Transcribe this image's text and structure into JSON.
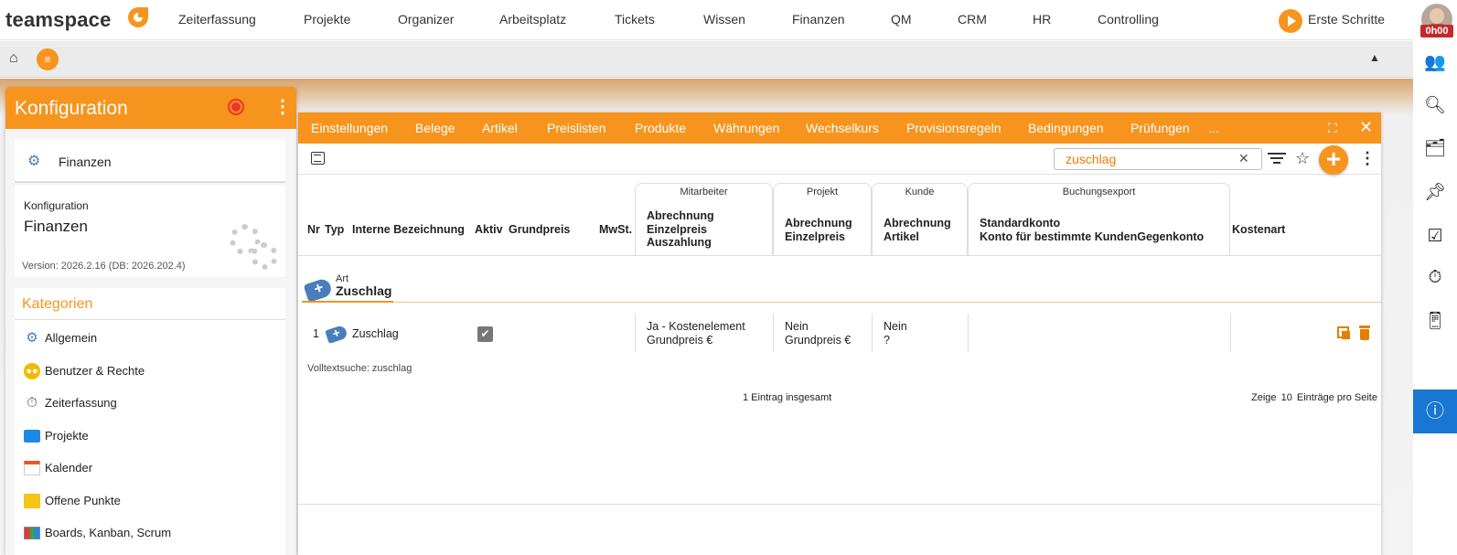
{
  "app": {
    "logo": "teamspace",
    "start_label": "Erste Schritte",
    "timer": "0h00"
  },
  "topnav": [
    "Zeiterfassung",
    "Projekte",
    "Organizer",
    "Arbeitsplatz",
    "Tickets",
    "Wissen",
    "Finanzen",
    "QM",
    "CRM",
    "HR",
    "Controlling"
  ],
  "left_panel": {
    "title": "Konfiguration",
    "card_label": "Finanzen",
    "section_small": "Konfiguration",
    "section_big": "Finanzen",
    "version": "Version: 2026.2.16 (DB: 2026.202.4)",
    "categories_title": "Kategorien",
    "categories": [
      "Allgemein",
      "Benutzer & Rechte",
      "Zeiterfassung",
      "Projekte",
      "Kalender",
      "Offene Punkte",
      "Boards, Kanban, Scrum"
    ]
  },
  "tabs": [
    "Einstellungen",
    "Belege",
    "Artikel",
    "Preislisten",
    "Produkte",
    "Währungen",
    "Wechselkurs",
    "Provisionsregeln",
    "Bedingungen",
    "Prüfungen",
    "..."
  ],
  "search": {
    "value": "zuschlag"
  },
  "columns": {
    "nr": "Nr",
    "typ": "Typ",
    "bezeichnung": "Interne Bezeichnung",
    "aktiv": "Aktiv",
    "grundpreis": "Grundpreis",
    "mwst": "MwSt.",
    "mitarbeiter_group": "Mitarbeiter",
    "mitarbeiter_col": "Abrechnung\nEinzelpreis\nAuszahlung",
    "projekt_group": "Projekt",
    "projekt_col": "Abrechnung\nEinzelpreis",
    "kunde_group": "Kunde",
    "kunde_col": "Abrechnung\nArtikel",
    "buchung_group": "Buchungsexport",
    "buchung_col": "Standardkonto\nKonto für bestimmte KundenGegenkonto",
    "kostenart": "Kostenart"
  },
  "group": {
    "label_small": "Art",
    "label_big": "Zuschlag"
  },
  "rows": [
    {
      "nr": "1",
      "bezeichnung": "Zuschlag",
      "aktiv": true,
      "mitarbeiter": "Ja - Kostenelement\nGrundpreis €",
      "projekt": "Nein\nGrundpreis €",
      "kunde": "Nein\n?"
    }
  ],
  "footer": {
    "fulltext": "Volltextsuche: zuschlag",
    "total": "1 Eintrag insgesamt",
    "perpage_prefix": "Zeige",
    "perpage_value": "10",
    "perpage_suffix": "Einträge pro Seite"
  },
  "colors": {
    "accent": "#f7941d",
    "info": "#1976d2"
  },
  "icons": {
    "rail": [
      "users-icon",
      "search-icon",
      "inbox-icon",
      "pin-icon",
      "tasks-icon",
      "stopwatch-icon",
      "phone-icon",
      "info-icon"
    ]
  }
}
